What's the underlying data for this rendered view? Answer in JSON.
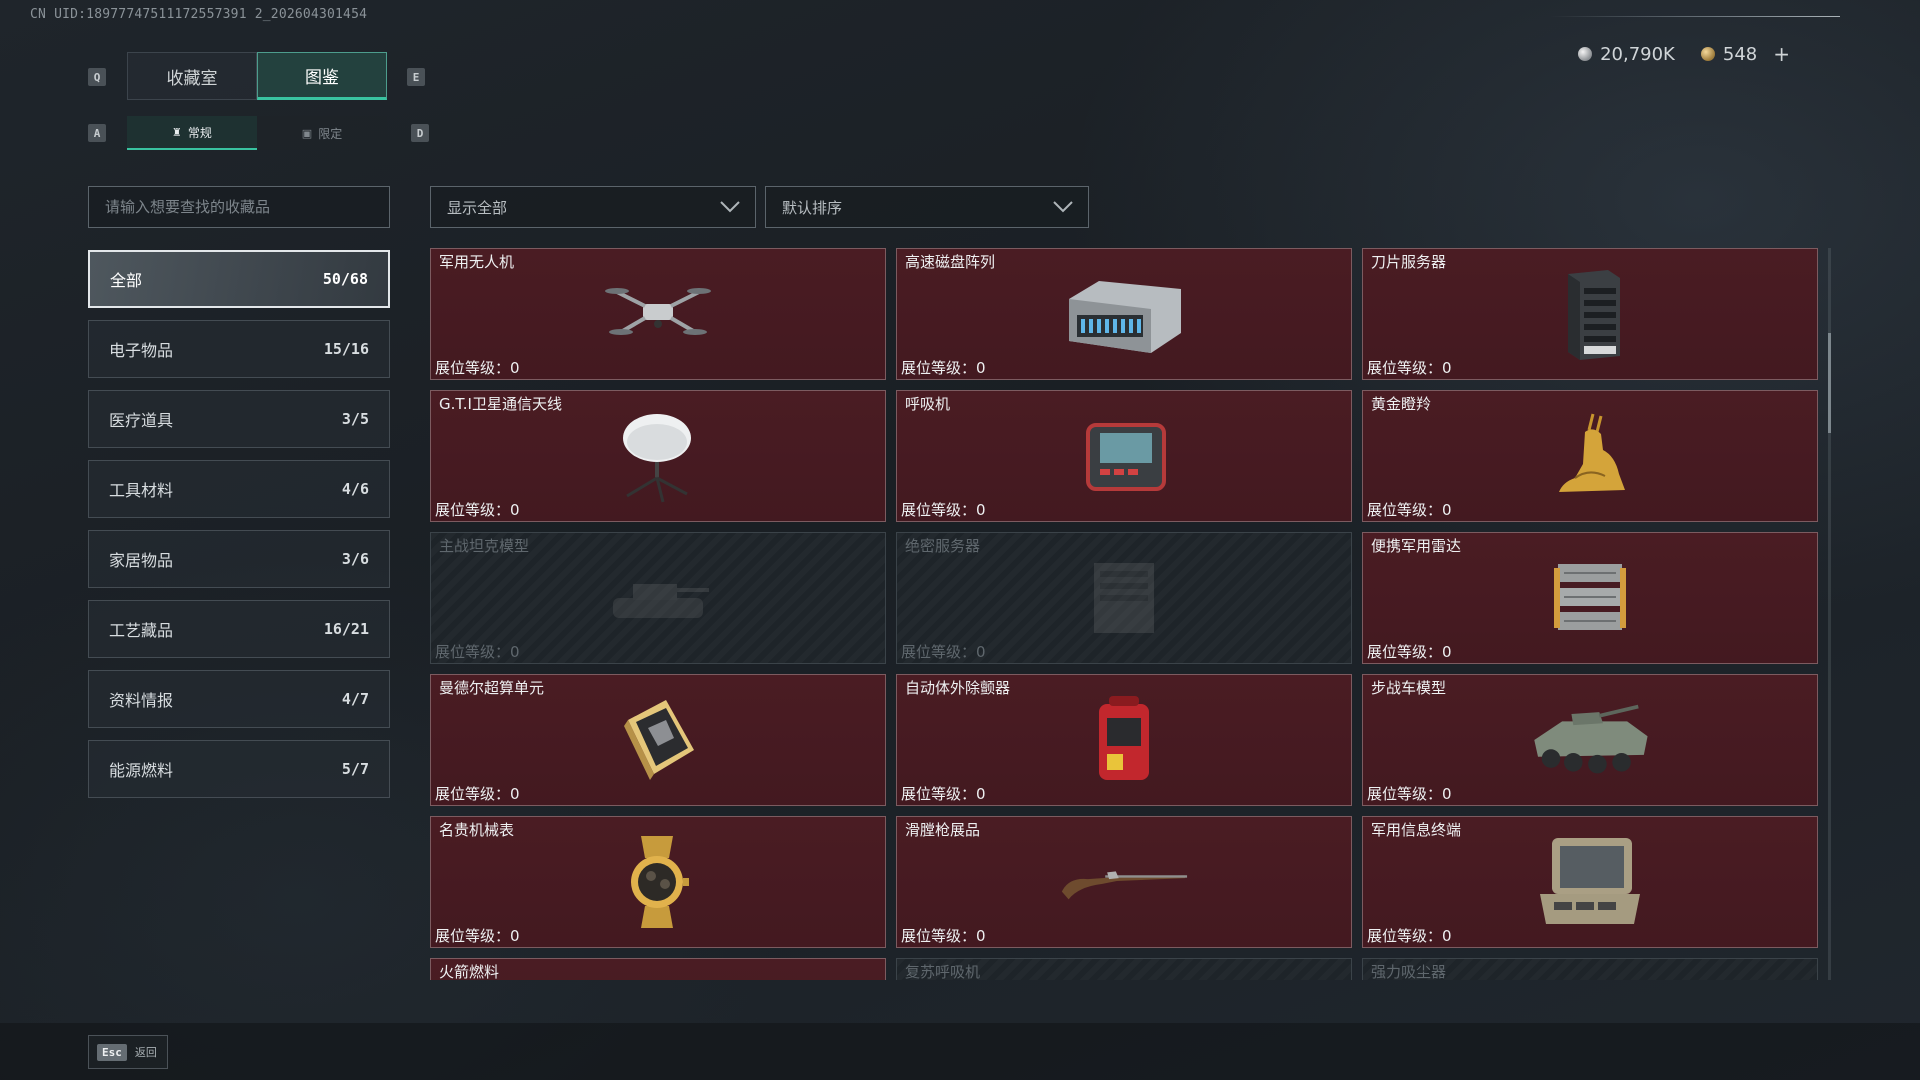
{
  "uid": "CN UID:18977747511172557391 2_202604301454",
  "currency": {
    "silver": "20,790K",
    "gold": "548",
    "plus": "+"
  },
  "keys": {
    "q": "Q",
    "e": "E",
    "a": "A",
    "d": "D"
  },
  "tabs": [
    {
      "label": "收藏室"
    },
    {
      "label": "图鉴"
    }
  ],
  "subtabs": [
    {
      "label": "常规"
    },
    {
      "label": "限定"
    }
  ],
  "search": {
    "placeholder": "请输入想要查找的收藏品"
  },
  "filters": {
    "show": "显示全部",
    "sort": "默认排序"
  },
  "categories": [
    {
      "label": "全部",
      "count": "50/68"
    },
    {
      "label": "电子物品",
      "count": "15/16"
    },
    {
      "label": "医疗道具",
      "count": "3/5"
    },
    {
      "label": "工具材料",
      "count": "4/6"
    },
    {
      "label": "家居物品",
      "count": "3/6"
    },
    {
      "label": "工艺藏品",
      "count": "16/21"
    },
    {
      "label": "资料情报",
      "count": "4/7"
    },
    {
      "label": "能源燃料",
      "count": "5/7"
    }
  ],
  "level_label": "展位等级：",
  "items": [
    {
      "name": "军用无人机",
      "level": "0",
      "icon": "drone-icon",
      "locked": false
    },
    {
      "name": "高速磁盘阵列",
      "level": "0",
      "icon": "disk-array-icon",
      "locked": false
    },
    {
      "name": "刀片服务器",
      "level": "0",
      "icon": "blade-server-icon",
      "locked": false
    },
    {
      "name": "G.T.I卫星通信天线",
      "level": "0",
      "icon": "satellite-dish-icon",
      "locked": false
    },
    {
      "name": "呼吸机",
      "level": "0",
      "icon": "ventilator-icon",
      "locked": false
    },
    {
      "name": "黄金瞪羚",
      "level": "0",
      "icon": "gold-gazelle-icon",
      "locked": false
    },
    {
      "name": "主战坦克模型",
      "level": "0",
      "icon": "tank-model-icon",
      "locked": true
    },
    {
      "name": "绝密服务器",
      "level": "0",
      "icon": "secret-server-icon",
      "locked": true
    },
    {
      "name": "便携军用雷达",
      "level": "0",
      "icon": "portable-radar-icon",
      "locked": false
    },
    {
      "name": "曼德尔超算单元",
      "level": "0",
      "icon": "compute-unit-icon",
      "locked": false
    },
    {
      "name": "自动体外除颤器",
      "level": "0",
      "icon": "defibrillator-icon",
      "locked": false
    },
    {
      "name": "步战车模型",
      "level": "0",
      "icon": "ifv-model-icon",
      "locked": false
    },
    {
      "name": "名贵机械表",
      "level": "0",
      "icon": "luxury-watch-icon",
      "locked": false
    },
    {
      "name": "滑膛枪展品",
      "level": "0",
      "icon": "musket-icon",
      "locked": false
    },
    {
      "name": "军用信息终端",
      "level": "0",
      "icon": "info-terminal-icon",
      "locked": false
    },
    {
      "name": "火箭燃料",
      "level": "",
      "icon": "rocket-fuel-icon",
      "locked": false
    },
    {
      "name": "复苏呼吸机",
      "level": "",
      "icon": "resuscitator-icon",
      "locked": true
    },
    {
      "name": "强力吸尘器",
      "level": "",
      "icon": "vacuum-icon",
      "locked": true
    }
  ],
  "footer": {
    "key": "Esc",
    "label": "返回"
  }
}
